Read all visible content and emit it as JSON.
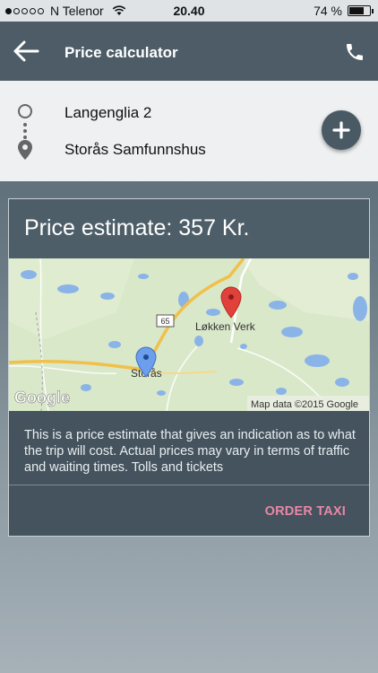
{
  "status_bar": {
    "carrier": "N Telenor",
    "time": "20.40",
    "battery_percent_text": "74 %",
    "battery_level": 0.74
  },
  "app_bar": {
    "title": "Price calculator",
    "back_icon": "arrow-left-icon",
    "call_icon": "phone-icon"
  },
  "route": {
    "from": "Langenglia 2",
    "to": "Storås Samfunnshus",
    "add_stop_icon": "plus-icon"
  },
  "card": {
    "estimate": "Price estimate: 357 Kr.",
    "map": {
      "place_origin": "Storås",
      "place_destination": "Løkken Verk",
      "road_number": "65",
      "logo": "Google",
      "attribution": "Map data ©2015 Google"
    },
    "description": "This is a price estimate that gives an indication as to what the trip will cost. Actual prices may vary in terms of traffic and waiting times. Tolls and tickets",
    "order_label": "ORDER TAXI"
  },
  "colors": {
    "accent": "#e987a8",
    "app_bar": "#4d5c66",
    "route_panel": "#eef0f2",
    "map_land": "#d7e8c8",
    "map_water": "#8ab4e8",
    "road": "#f0c04a"
  }
}
